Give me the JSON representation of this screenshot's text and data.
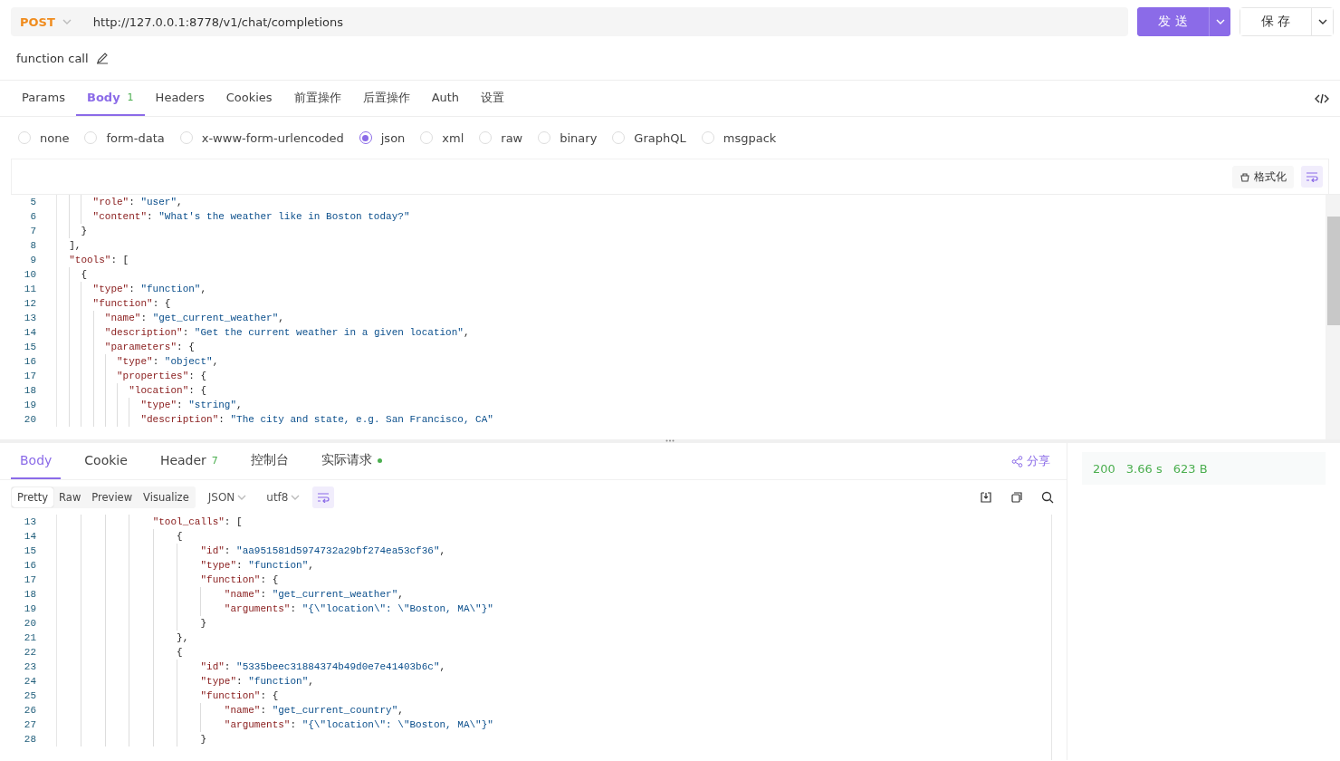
{
  "request": {
    "method": "POST",
    "url": "http://127.0.0.1:8778/v1/chat/completions",
    "send_label": "发 送",
    "save_label": "保 存",
    "name": "function call"
  },
  "tabs": [
    {
      "label": "Params",
      "selected": false
    },
    {
      "label": "Body",
      "badge": "1",
      "selected": true
    },
    {
      "label": "Headers",
      "selected": false
    },
    {
      "label": "Cookies",
      "selected": false
    },
    {
      "label": "前置操作",
      "selected": false
    },
    {
      "label": "后置操作",
      "selected": false
    },
    {
      "label": "Auth",
      "selected": false
    },
    {
      "label": "设置",
      "selected": false
    }
  ],
  "body_types": [
    {
      "label": "none",
      "selected": false
    },
    {
      "label": "form-data",
      "selected": false
    },
    {
      "label": "x-www-form-urlencoded",
      "selected": false
    },
    {
      "label": "json",
      "selected": true
    },
    {
      "label": "xml",
      "selected": false
    },
    {
      "label": "raw",
      "selected": false
    },
    {
      "label": "binary",
      "selected": false
    },
    {
      "label": "GraphQL",
      "selected": false
    },
    {
      "label": "msgpack",
      "selected": false
    }
  ],
  "format_label": "格式化",
  "request_code": [
    {
      "num": "5",
      "tokens": [
        {
          "kind": "key",
          "text": "      \"role\""
        },
        {
          "kind": "punct",
          "text": ": "
        },
        {
          "kind": "string",
          "text": "\"user\""
        },
        {
          "kind": "punct",
          "text": ","
        }
      ]
    },
    {
      "num": "6",
      "tokens": [
        {
          "kind": "key",
          "text": "      \"content\""
        },
        {
          "kind": "punct",
          "text": ": "
        },
        {
          "kind": "string",
          "text": "\"What's the weather like in Boston today?\""
        }
      ]
    },
    {
      "num": "7",
      "tokens": [
        {
          "kind": "punct",
          "text": "    }"
        }
      ]
    },
    {
      "num": "8",
      "tokens": [
        {
          "kind": "punct",
          "text": "  ],"
        }
      ]
    },
    {
      "num": "9",
      "tokens": [
        {
          "kind": "key",
          "text": "  \"tools\""
        },
        {
          "kind": "punct",
          "text": ": ["
        }
      ]
    },
    {
      "num": "10",
      "tokens": [
        {
          "kind": "punct",
          "text": "    {"
        }
      ]
    },
    {
      "num": "11",
      "tokens": [
        {
          "kind": "key",
          "text": "      \"type\""
        },
        {
          "kind": "punct",
          "text": ": "
        },
        {
          "kind": "string",
          "text": "\"function\""
        },
        {
          "kind": "punct",
          "text": ","
        }
      ]
    },
    {
      "num": "12",
      "tokens": [
        {
          "kind": "key",
          "text": "      \"function\""
        },
        {
          "kind": "punct",
          "text": ": {"
        }
      ]
    },
    {
      "num": "13",
      "tokens": [
        {
          "kind": "key",
          "text": "        \"name\""
        },
        {
          "kind": "punct",
          "text": ": "
        },
        {
          "kind": "string",
          "text": "\"get_current_weather\""
        },
        {
          "kind": "punct",
          "text": ","
        }
      ]
    },
    {
      "num": "14",
      "tokens": [
        {
          "kind": "key",
          "text": "        \"description\""
        },
        {
          "kind": "punct",
          "text": ": "
        },
        {
          "kind": "string",
          "text": "\"Get the current weather in a given location\""
        },
        {
          "kind": "punct",
          "text": ","
        }
      ]
    },
    {
      "num": "15",
      "tokens": [
        {
          "kind": "key",
          "text": "        \"parameters\""
        },
        {
          "kind": "punct",
          "text": ": {"
        }
      ]
    },
    {
      "num": "16",
      "tokens": [
        {
          "kind": "key",
          "text": "          \"type\""
        },
        {
          "kind": "punct",
          "text": ": "
        },
        {
          "kind": "string",
          "text": "\"object\""
        },
        {
          "kind": "punct",
          "text": ","
        }
      ]
    },
    {
      "num": "17",
      "tokens": [
        {
          "kind": "key",
          "text": "          \"properties\""
        },
        {
          "kind": "punct",
          "text": ": {"
        }
      ]
    },
    {
      "num": "18",
      "tokens": [
        {
          "kind": "key",
          "text": "            \"location\""
        },
        {
          "kind": "punct",
          "text": ": {"
        }
      ]
    },
    {
      "num": "19",
      "tokens": [
        {
          "kind": "key",
          "text": "              \"type\""
        },
        {
          "kind": "punct",
          "text": ": "
        },
        {
          "kind": "string",
          "text": "\"string\""
        },
        {
          "kind": "punct",
          "text": ","
        }
      ]
    },
    {
      "num": "20",
      "tokens": [
        {
          "kind": "key",
          "text": "              \"description\""
        },
        {
          "kind": "punct",
          "text": ": "
        },
        {
          "kind": "string",
          "text": "\"The city and state, e.g. San Francisco, CA\""
        }
      ]
    }
  ],
  "response_tabs": [
    {
      "label": "Body",
      "selected": true
    },
    {
      "label": "Cookie",
      "selected": false
    },
    {
      "label": "Header",
      "badge": "7",
      "selected": false
    },
    {
      "label": "控制台",
      "selected": false
    },
    {
      "label": "实际请求",
      "dot": true,
      "selected": false
    }
  ],
  "share_label": "分享",
  "views": [
    {
      "label": "Pretty",
      "selected": true
    },
    {
      "label": "Raw",
      "selected": false
    },
    {
      "label": "Preview",
      "selected": false
    },
    {
      "label": "Visualize",
      "selected": false
    }
  ],
  "format_select": "JSON",
  "encoding_select": "utf8",
  "response_code": [
    {
      "num": "13",
      "tokens": [
        {
          "kind": "key",
          "text": "                \"tool_calls\""
        },
        {
          "kind": "punct",
          "text": ": ["
        }
      ]
    },
    {
      "num": "14",
      "tokens": [
        {
          "kind": "punct",
          "text": "                    {"
        }
      ]
    },
    {
      "num": "15",
      "tokens": [
        {
          "kind": "key",
          "text": "                        \"id\""
        },
        {
          "kind": "punct",
          "text": ": "
        },
        {
          "kind": "string",
          "text": "\"aa951581d5974732a29bf274ea53cf36\""
        },
        {
          "kind": "punct",
          "text": ","
        }
      ]
    },
    {
      "num": "16",
      "tokens": [
        {
          "kind": "key",
          "text": "                        \"type\""
        },
        {
          "kind": "punct",
          "text": ": "
        },
        {
          "kind": "string",
          "text": "\"function\""
        },
        {
          "kind": "punct",
          "text": ","
        }
      ]
    },
    {
      "num": "17",
      "tokens": [
        {
          "kind": "key",
          "text": "                        \"function\""
        },
        {
          "kind": "punct",
          "text": ": {"
        }
      ]
    },
    {
      "num": "18",
      "tokens": [
        {
          "kind": "key",
          "text": "                            \"name\""
        },
        {
          "kind": "punct",
          "text": ": "
        },
        {
          "kind": "string",
          "text": "\"get_current_weather\""
        },
        {
          "kind": "punct",
          "text": ","
        }
      ]
    },
    {
      "num": "19",
      "tokens": [
        {
          "kind": "key",
          "text": "                            \"arguments\""
        },
        {
          "kind": "punct",
          "text": ": "
        },
        {
          "kind": "string",
          "text": "\"{\\\"location\\\": \\\"Boston, MA\\\"}\""
        }
      ]
    },
    {
      "num": "20",
      "tokens": [
        {
          "kind": "punct",
          "text": "                        }"
        }
      ]
    },
    {
      "num": "21",
      "tokens": [
        {
          "kind": "punct",
          "text": "                    },"
        }
      ]
    },
    {
      "num": "22",
      "tokens": [
        {
          "kind": "punct",
          "text": "                    {"
        }
      ]
    },
    {
      "num": "23",
      "tokens": [
        {
          "kind": "key",
          "text": "                        \"id\""
        },
        {
          "kind": "punct",
          "text": ": "
        },
        {
          "kind": "string",
          "text": "\"5335beec31884374b49d0e7e41403b6c\""
        },
        {
          "kind": "punct",
          "text": ","
        }
      ]
    },
    {
      "num": "24",
      "tokens": [
        {
          "kind": "key",
          "text": "                        \"type\""
        },
        {
          "kind": "punct",
          "text": ": "
        },
        {
          "kind": "string",
          "text": "\"function\""
        },
        {
          "kind": "punct",
          "text": ","
        }
      ]
    },
    {
      "num": "25",
      "tokens": [
        {
          "kind": "key",
          "text": "                        \"function\""
        },
        {
          "kind": "punct",
          "text": ": {"
        }
      ]
    },
    {
      "num": "26",
      "tokens": [
        {
          "kind": "key",
          "text": "                            \"name\""
        },
        {
          "kind": "punct",
          "text": ": "
        },
        {
          "kind": "string",
          "text": "\"get_current_country\""
        },
        {
          "kind": "punct",
          "text": ","
        }
      ]
    },
    {
      "num": "27",
      "tokens": [
        {
          "kind": "key",
          "text": "                            \"arguments\""
        },
        {
          "kind": "punct",
          "text": ": "
        },
        {
          "kind": "string",
          "text": "\"{\\\"location\\\": \\\"Boston, MA\\\"}\""
        }
      ]
    },
    {
      "num": "28",
      "tokens": [
        {
          "kind": "punct",
          "text": "                        }"
        }
      ]
    }
  ],
  "status": {
    "code": "200",
    "time": "3.66 s",
    "size": "623 B"
  }
}
